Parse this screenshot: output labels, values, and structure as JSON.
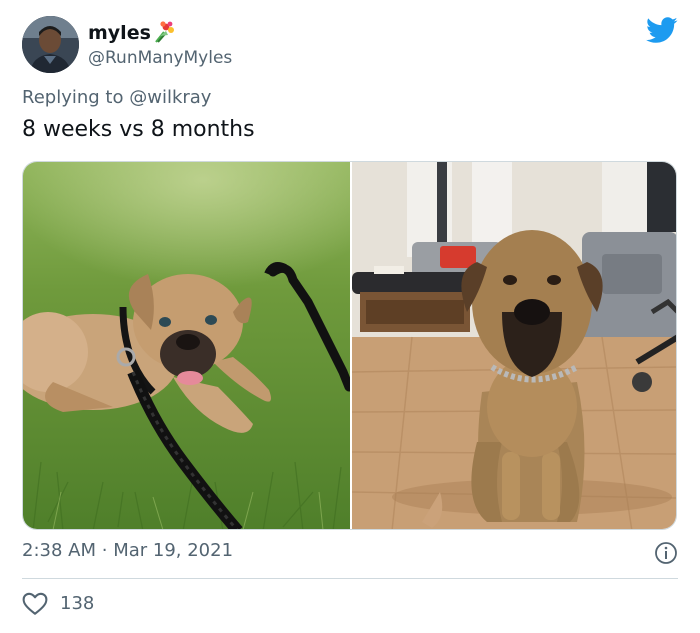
{
  "author": {
    "display_name": "myles",
    "name_emoji": "bouquet-emoji",
    "handle": "@RunManyMyles"
  },
  "reply": {
    "prefix": "Replying to",
    "mention": "@wilkray"
  },
  "tweet": {
    "text": "8 weeks vs 8 months"
  },
  "media": {
    "images": [
      {
        "name": "puppy-photo"
      },
      {
        "name": "grown-dog-photo"
      }
    ]
  },
  "meta": {
    "time": "2:38 AM",
    "separator": "·",
    "date": "Mar 19, 2021"
  },
  "engagement": {
    "likes": "138"
  },
  "colors": {
    "brand_blue": "#1d9bf0",
    "secondary_text": "#536471",
    "border": "#cfd9de"
  },
  "icons": [
    "twitter-bird-icon",
    "info-icon",
    "heart-icon",
    "bouquet-emoji"
  ]
}
